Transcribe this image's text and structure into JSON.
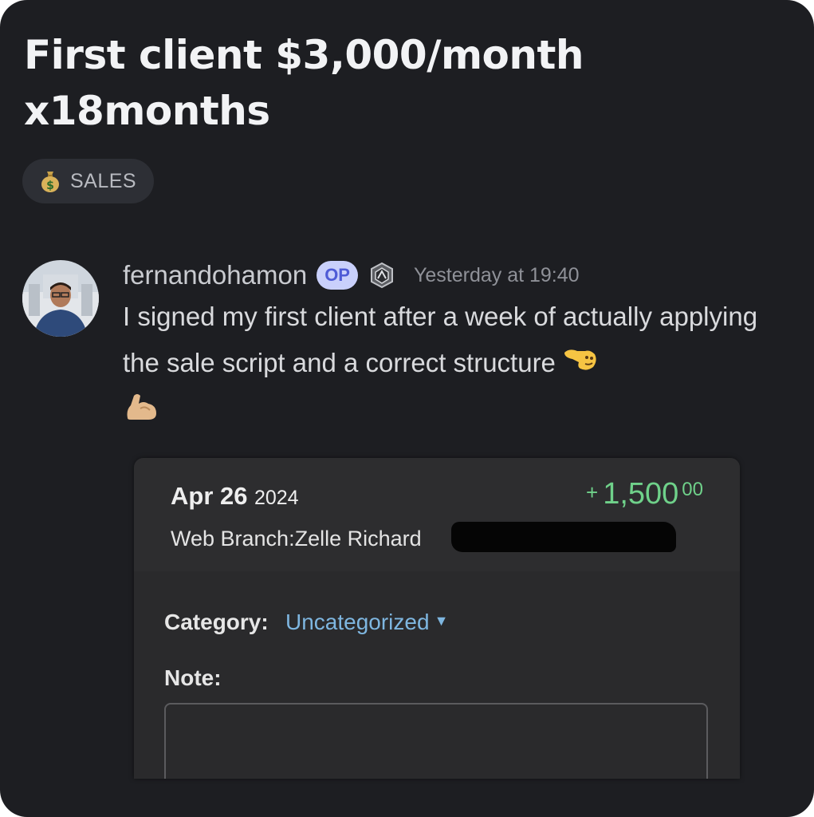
{
  "post": {
    "title": "First client $3,000/month x18months",
    "tag": {
      "icon": "money-bag-icon",
      "label": "SALES"
    }
  },
  "message": {
    "username": "fernandohamon",
    "op_badge": "OP",
    "role_icon": "shield-badge-icon",
    "timestamp": "Yesterday at 19:40",
    "text": "I signed my first client after a week of actually applying the sale script and a correct structure",
    "emojis": [
      "pointing-hand-icon",
      "flexed-biceps-icon"
    ]
  },
  "attachment": {
    "date_main": "Apr 26",
    "date_year": "2024",
    "amount_sign": "+",
    "amount_main": "1,500",
    "amount_cents": "00",
    "branch": "Web Branch:Zelle Richard",
    "category_label": "Category:",
    "category_value": "Uncategorized",
    "note_label": "Note:",
    "note_value": ""
  },
  "colors": {
    "background": "#1d1e22",
    "op_badge_bg": "#c9d0fb",
    "op_badge_text": "#4e5bd6",
    "amount": "#6fd18a",
    "category_link": "#7eb6e0"
  }
}
